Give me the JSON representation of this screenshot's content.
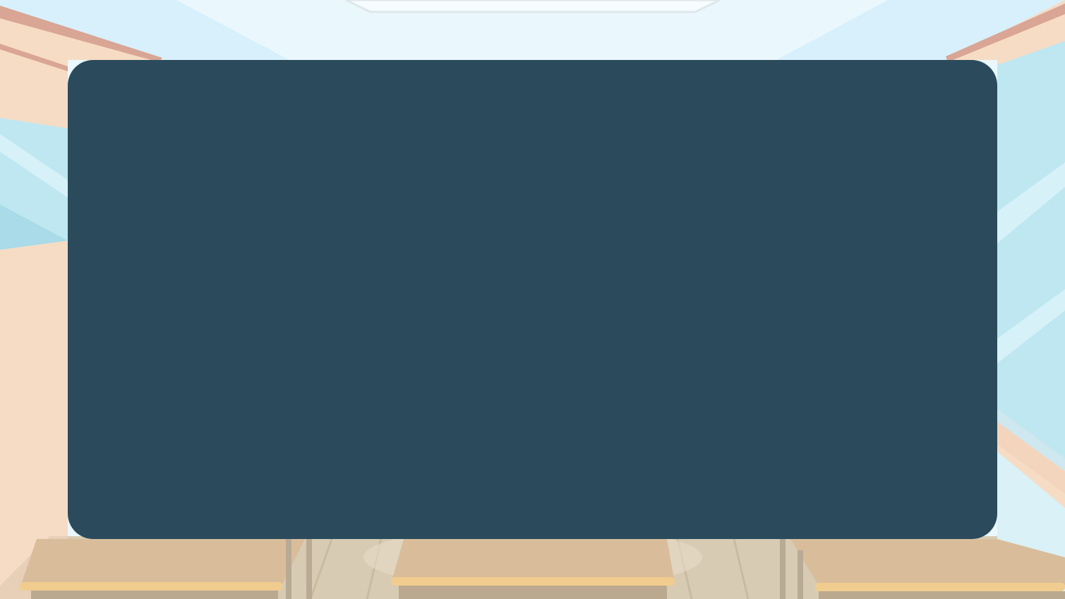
{
  "colors": {
    "board": "#2b4b5d",
    "ceiling": "#eaf8fd",
    "ceiling_edge": "#d3eefa",
    "wall": "#f6dcc4",
    "wall_trim": "#d9a594",
    "window_glass": "#bfe7f1",
    "window_glass_dark": "#a9dbe8",
    "desk_top": "#d9bd9a",
    "desk_edge": "#f1cc8f",
    "floor": "#d8cbb3"
  },
  "board": {
    "text": ""
  }
}
